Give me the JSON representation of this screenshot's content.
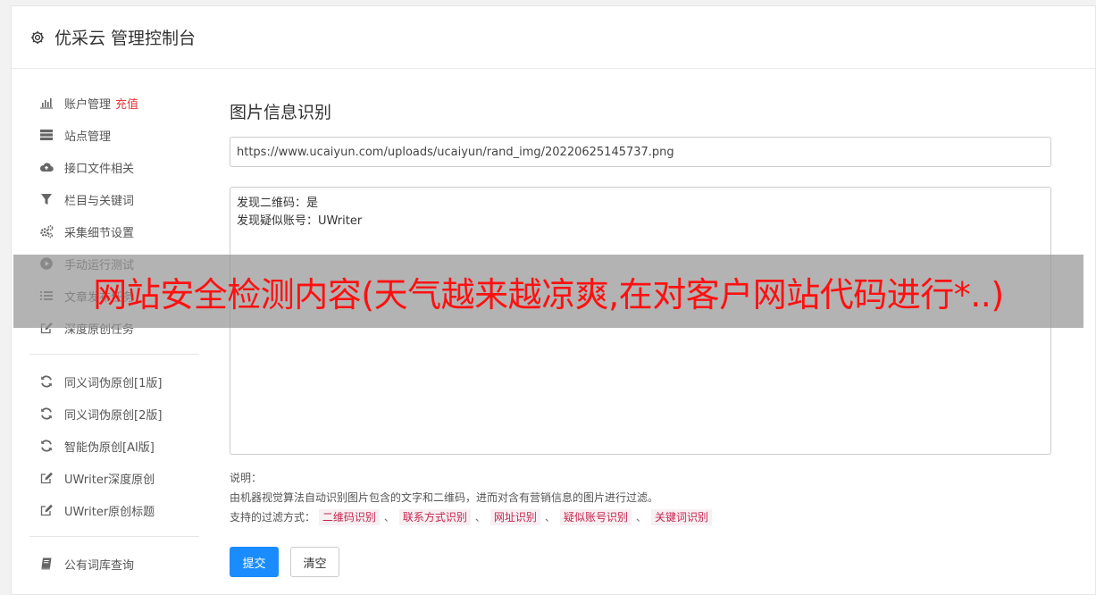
{
  "header": {
    "title": "优采云 管理控制台",
    "icon": "gear-icon"
  },
  "sidebar": {
    "groups": [
      [
        {
          "label": "账户管理",
          "badge": "充值",
          "icon": "bar-chart-icon"
        },
        {
          "label": "站点管理",
          "icon": "server-icon"
        },
        {
          "label": "接口文件相关",
          "icon": "cloud-upload-icon"
        },
        {
          "label": "栏目与关键词",
          "icon": "filter-icon"
        },
        {
          "label": "采集细节设置",
          "icon": "cogs-icon"
        },
        {
          "label": "手动运行测试",
          "icon": "play-circle-icon"
        },
        {
          "label": "文章发布任务",
          "icon": "list-icon"
        },
        {
          "label": "深度原创任务",
          "icon": "edit-icon"
        }
      ],
      [
        {
          "label": "同义词伪原创[1版]",
          "icon": "refresh-icon"
        },
        {
          "label": "同义词伪原创[2版]",
          "icon": "refresh-icon"
        },
        {
          "label": "智能伪原创[AI版]",
          "icon": "refresh-icon"
        },
        {
          "label": "UWriter深度原创",
          "icon": "edit-icon"
        },
        {
          "label": "UWriter原创标题",
          "icon": "edit-icon"
        }
      ],
      [
        {
          "label": "公有词库查询",
          "icon": "book-icon"
        }
      ]
    ]
  },
  "main": {
    "section_title": "图片信息识别",
    "url_value": "https://www.ucaiyun.com/uploads/ucaiyun/rand_img/20220625145737.png",
    "result_lines": [
      "发现二维码：是",
      "发现疑似账号：UWriter"
    ],
    "note_label": "说明：",
    "note_desc": "由机器视觉算法自动识别图片包含的文字和二维码，进而对含有营销信息的图片进行过滤。",
    "filter_label": "支持的过滤方式：",
    "filter_tags": [
      "二维码识别",
      "联系方式识别",
      "网址识别",
      "疑似账号识别",
      "关键词识别"
    ],
    "tag_separator": "、",
    "submit_label": "提交",
    "clear_label": "清空"
  },
  "overlay": {
    "text": "网站安全检测内容(天气越来越凉爽,在对客户网站代码进行*..)"
  },
  "colors": {
    "accent": "#1a8cff",
    "badge": "#e4393c",
    "overlay_text": "#ff1010"
  }
}
